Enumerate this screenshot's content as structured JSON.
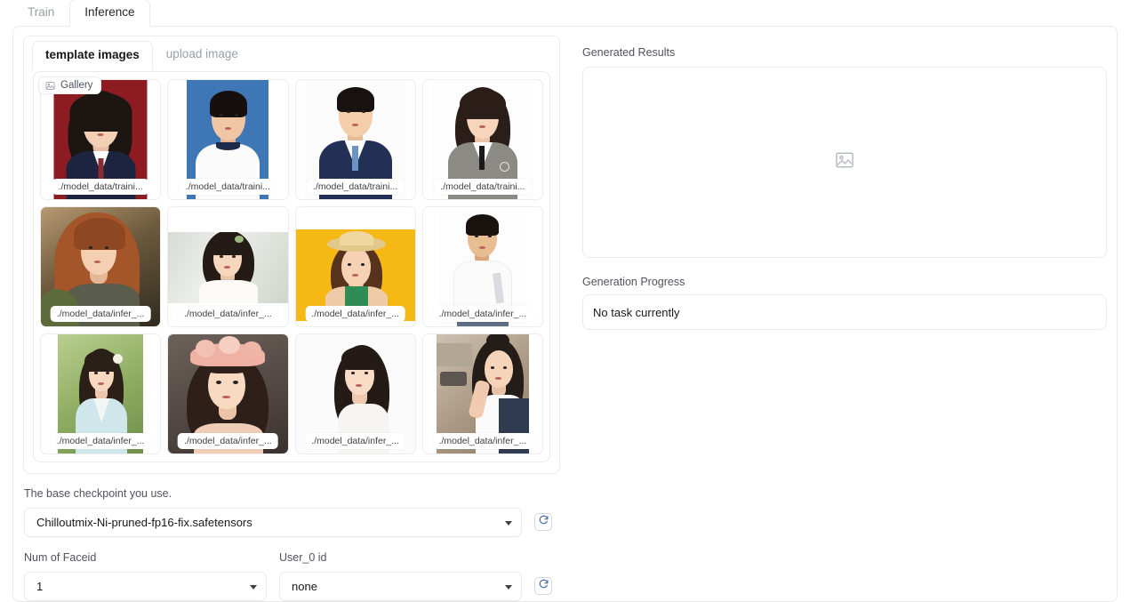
{
  "top_tabs": [
    {
      "label": "Train",
      "active": false
    },
    {
      "label": "Inference",
      "active": true
    }
  ],
  "sub_tabs": [
    {
      "label": "template images",
      "active": true
    },
    {
      "label": "upload image",
      "active": false
    }
  ],
  "gallery": {
    "badge_label": "Gallery",
    "badge_icon": "image-icon",
    "items": [
      {
        "caption": "./model_data/traini...",
        "desc": "woman in school uniform on dark red background"
      },
      {
        "caption": "./model_data/traini...",
        "desc": "young man in white tee on blue background"
      },
      {
        "caption": "./model_data/traini...",
        "desc": "young man in navy suit with blue tie on white"
      },
      {
        "caption": "./model_data/traini...",
        "desc": "woman in grey blazer with black tie on white"
      },
      {
        "caption": "./model_data/infer_...",
        "desc": "woman with long auburn hair outdoors"
      },
      {
        "caption": "./model_data/infer_...",
        "desc": "woman in white dress by a window"
      },
      {
        "caption": "./model_data/infer_...",
        "desc": "woman with straw hat on yellow background"
      },
      {
        "caption": "./model_data/infer_...",
        "desc": "man in white tee holding a laptop"
      },
      {
        "caption": "./model_data/infer_...",
        "desc": "woman in light blue shirt in a park"
      },
      {
        "caption": "./model_data/infer_...",
        "desc": "woman with pink flower crown"
      },
      {
        "caption": "./model_data/infer_...",
        "desc": "woman with long dark hair on white background"
      },
      {
        "caption": "./model_data/infer_...",
        "desc": "woman seated at a desk indoors"
      }
    ]
  },
  "results": {
    "title": "Generated Results",
    "placeholder_icon": "image-placeholder-icon",
    "progress_title": "Generation Progress",
    "progress_status": "No task currently"
  },
  "form": {
    "checkpoint_label": "The base checkpoint you use.",
    "checkpoint_value": "Chilloutmix-Ni-pruned-fp16-fix.safetensors",
    "faceid_label": "Num of Faceid",
    "faceid_value": "1",
    "user_label": "User_0 id",
    "user_value": "none",
    "refresh_icon": "refresh-icon"
  },
  "colors": {
    "border": "#ebebeb",
    "text": "#18181b",
    "muted": "#9aa0a6"
  }
}
